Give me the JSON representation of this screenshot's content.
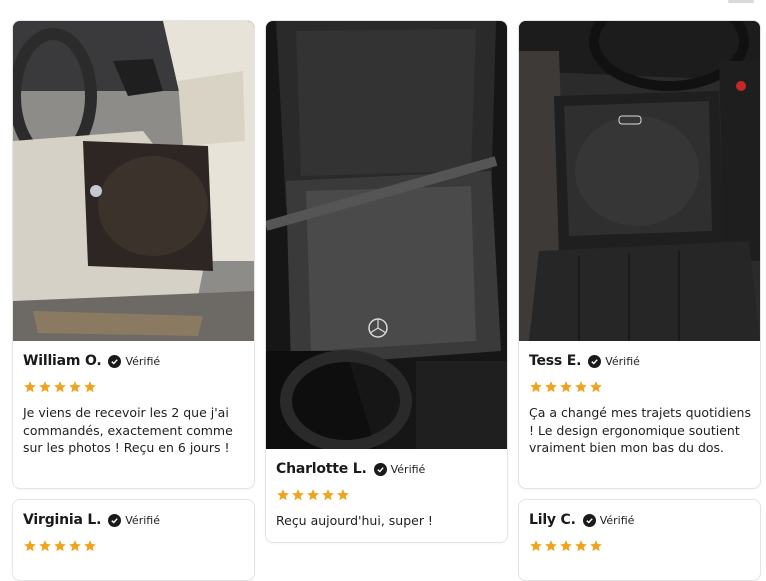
{
  "colors": {
    "star": "#f0a31e",
    "verified_badge": "#1a1a1a",
    "card_border": "#e4e4e4"
  },
  "icons": {
    "verified": "check-badge-icon",
    "rating": "star-icon"
  },
  "reviews": [
    {
      "name": "William O.",
      "verified": "Vérifié",
      "rating": 5,
      "text": "Je viens de recevoir les 2 que j'ai commandés, exactement comme sur les photos ! Reçu en 6 jours !"
    },
    {
      "name": "Charlotte L.",
      "verified": "Vérifié",
      "rating": 5,
      "text": "Reçu aujourd'hui, super !"
    },
    {
      "name": "Tess E.",
      "verified": "Vérifié",
      "rating": 5,
      "text": "Ça a changé mes trajets quotidiens ! Le design ergonomique soutient vraiment bien mon bas du dos."
    },
    {
      "name": "Virginia L.",
      "verified": "Vérifié",
      "rating": 5,
      "text": ""
    },
    {
      "name": "Lily C.",
      "verified": "Vérifié",
      "rating": 5,
      "text": ""
    }
  ]
}
